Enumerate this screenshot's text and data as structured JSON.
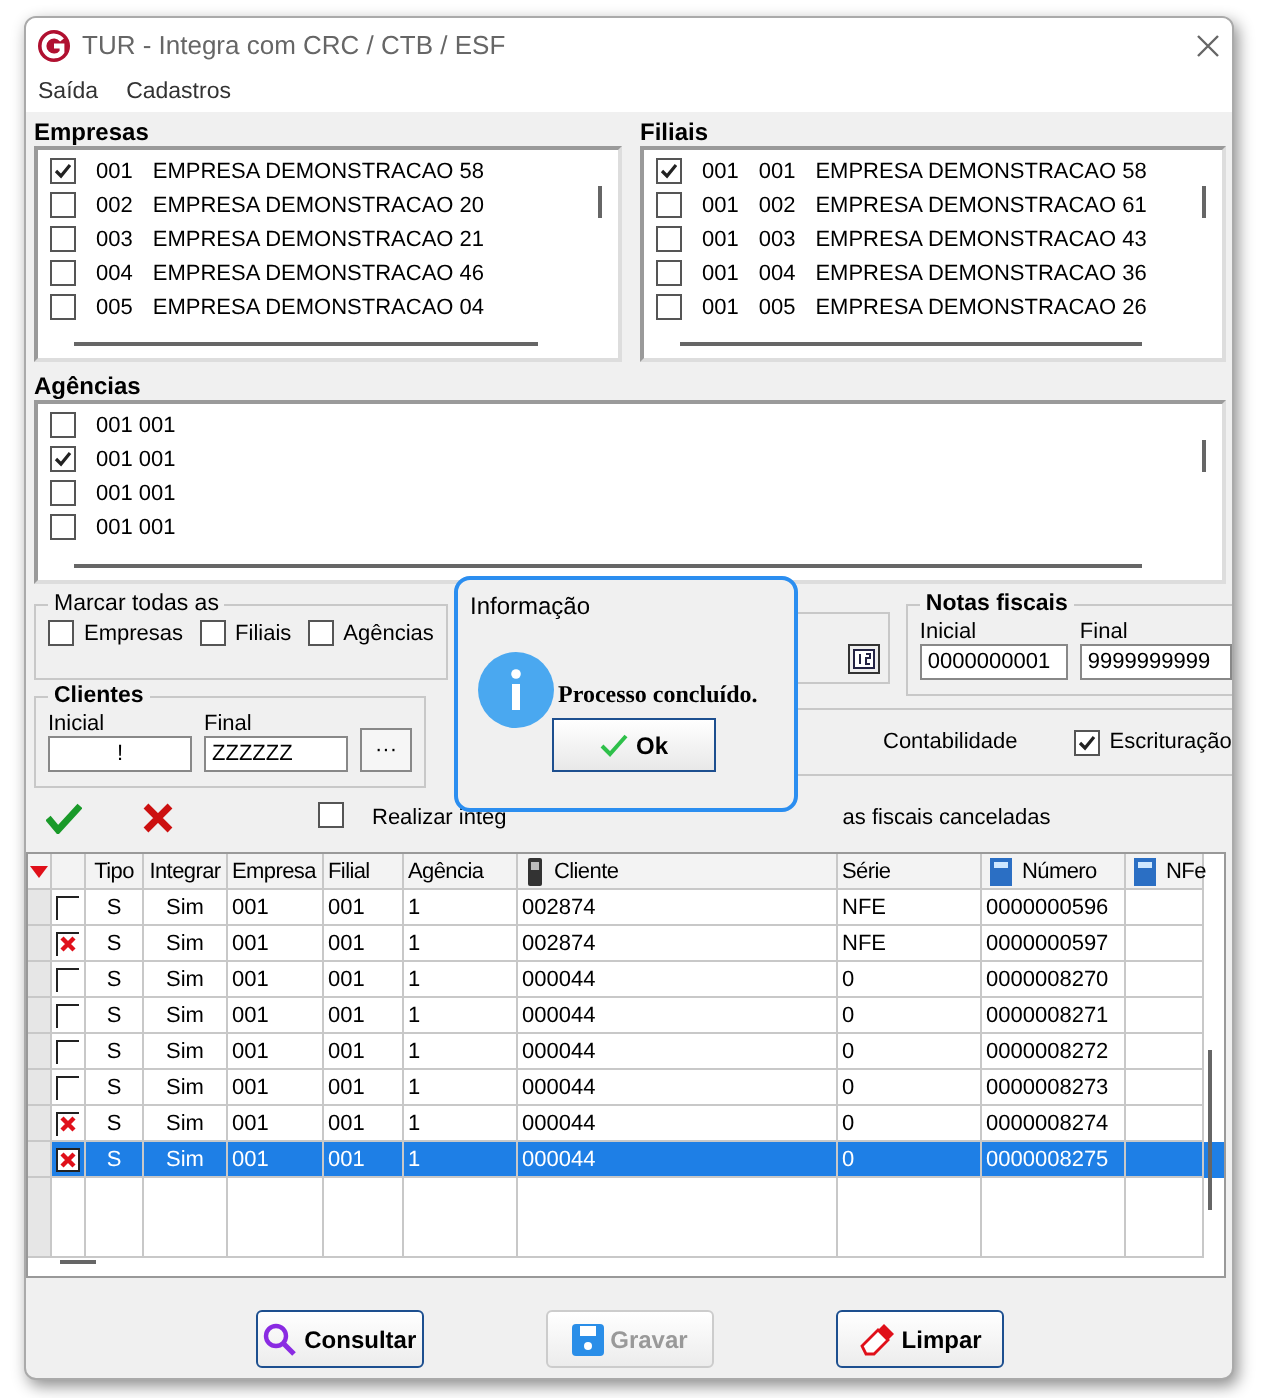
{
  "window": {
    "title": "TUR - Integra com CRC / CTB / ESF"
  },
  "menu": [
    {
      "label": "Saída"
    },
    {
      "label": "Cadastros"
    }
  ],
  "empresas": {
    "label": "Empresas",
    "items": [
      {
        "code": "001",
        "name": "EMPRESA DEMONSTRACAO 58",
        "checked": true
      },
      {
        "code": "002",
        "name": "EMPRESA DEMONSTRACAO 20",
        "checked": false
      },
      {
        "code": "003",
        "name": "EMPRESA DEMONSTRACAO 21",
        "checked": false
      },
      {
        "code": "004",
        "name": "EMPRESA DEMONSTRACAO 46",
        "checked": false
      },
      {
        "code": "005",
        "name": "EMPRESA DEMONSTRACAO 04",
        "checked": false
      }
    ]
  },
  "filiais": {
    "label": "Filiais",
    "items": [
      {
        "empresa": "001",
        "code": "001",
        "name": "EMPRESA DEMONSTRACAO 58",
        "checked": true
      },
      {
        "empresa": "001",
        "code": "002",
        "name": "EMPRESA DEMONSTRACAO 61",
        "checked": false
      },
      {
        "empresa": "001",
        "code": "003",
        "name": "EMPRESA DEMONSTRACAO 43",
        "checked": false
      },
      {
        "empresa": "001",
        "code": "004",
        "name": "EMPRESA DEMONSTRACAO 36",
        "checked": false
      },
      {
        "empresa": "001",
        "code": "005",
        "name": "EMPRESA DEMONSTRACAO 26",
        "checked": false
      }
    ]
  },
  "agencias": {
    "label": "Agências",
    "items": [
      {
        "code": "001 001",
        "checked": false
      },
      {
        "code": "001 001",
        "checked": true
      },
      {
        "code": "001 001",
        "checked": false
      },
      {
        "code": "001 001",
        "checked": false
      }
    ]
  },
  "marcar": {
    "label": "Marcar todas as",
    "options": [
      {
        "label": "Empresas",
        "checked": false
      },
      {
        "label": "Filiais",
        "checked": false
      },
      {
        "label": "Agências",
        "checked": false
      }
    ]
  },
  "clientes": {
    "label": "Clientes",
    "inicial_label": "Inicial",
    "inicial": "!",
    "final_label": "Final",
    "final": "ZZZZZZ",
    "lookup": "···"
  },
  "notas": {
    "label": "Notas fiscais",
    "inicial_label": "Inicial",
    "inicial": "0000000001",
    "final_label": "Final",
    "final": "9999999999"
  },
  "integracao": {
    "contabilidade": "Contabilidade",
    "escrituracao": {
      "label": "Escrituração",
      "checked": true
    }
  },
  "realizar": {
    "label": "Realizar integ",
    "checked": false,
    "tail": "as fiscais canceladas"
  },
  "grid": {
    "columns": [
      "Tipo",
      "Integrar",
      "Empresa",
      "Filial",
      "Agência",
      "Cliente",
      "Série",
      "Número",
      "NFe"
    ],
    "rows": [
      {
        "marked": false,
        "selected": false,
        "cells": [
          "S",
          "Sim",
          "001",
          "001",
          "1",
          "002874",
          "NFE",
          "0000000596"
        ]
      },
      {
        "marked": true,
        "selected": false,
        "cells": [
          "S",
          "Sim",
          "001",
          "001",
          "1",
          "002874",
          "NFE",
          "0000000597"
        ]
      },
      {
        "marked": false,
        "selected": false,
        "cells": [
          "S",
          "Sim",
          "001",
          "001",
          "1",
          "000044",
          "0",
          "0000008270"
        ]
      },
      {
        "marked": false,
        "selected": false,
        "cells": [
          "S",
          "Sim",
          "001",
          "001",
          "1",
          "000044",
          "0",
          "0000008271"
        ]
      },
      {
        "marked": false,
        "selected": false,
        "cells": [
          "S",
          "Sim",
          "001",
          "001",
          "1",
          "000044",
          "0",
          "0000008272"
        ]
      },
      {
        "marked": false,
        "selected": false,
        "cells": [
          "S",
          "Sim",
          "001",
          "001",
          "1",
          "000044",
          "0",
          "0000008273"
        ]
      },
      {
        "marked": true,
        "selected": false,
        "cells": [
          "S",
          "Sim",
          "001",
          "001",
          "1",
          "000044",
          "0",
          "0000008274"
        ]
      },
      {
        "marked": true,
        "selected": true,
        "cells": [
          "S",
          "Sim",
          "001",
          "001",
          "1",
          "000044",
          "0",
          "0000008275"
        ]
      }
    ]
  },
  "dialog": {
    "title": "Informação",
    "message": "Processo concluído.",
    "button": "Ok"
  },
  "buttons": [
    {
      "kind": "search",
      "label": "Consultar",
      "disabled": false
    },
    {
      "kind": "save",
      "label": "Gravar",
      "disabled": true
    },
    {
      "kind": "clear",
      "label": "Limpar",
      "disabled": false
    }
  ]
}
